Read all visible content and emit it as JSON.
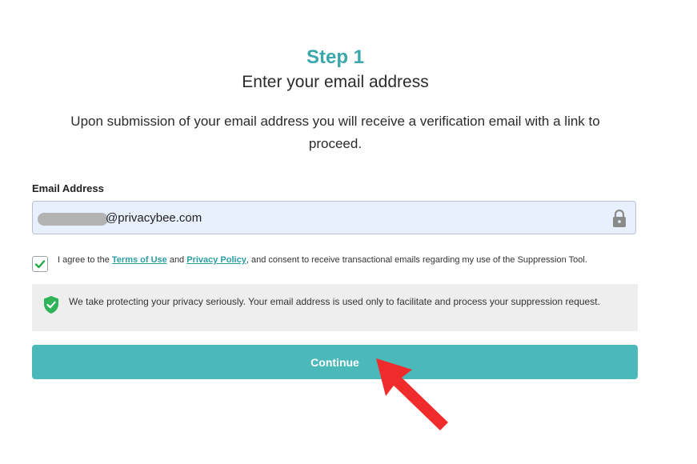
{
  "header": {
    "step_title": "Step 1",
    "subtitle": "Enter your email address"
  },
  "intro": {
    "text": "Upon submission of your email address you will receive a verification email with a link to proceed."
  },
  "email_field": {
    "label": "Email Address",
    "value_visible": "@privacybee.com",
    "icon": "lock-icon"
  },
  "consent": {
    "checked": true,
    "prefix": "I agree to the ",
    "terms_link": "Terms of Use",
    "and": " and ",
    "privacy_link": "Privacy Policy",
    "suffix": ", and consent to receive transactional emails regarding my use of the Suppression Tool."
  },
  "privacy_notice": {
    "icon": "shield-check-icon",
    "text": "We take protecting your privacy seriously. Your email address is used only to facilitate and process your suppression request."
  },
  "continue_button": {
    "label": "Continue"
  },
  "colors": {
    "accent": "#3aa7aa",
    "button": "#4bb8b9",
    "arrow": "#f02b2b",
    "shield": "#2fb35a",
    "checkmark": "#27a845"
  }
}
